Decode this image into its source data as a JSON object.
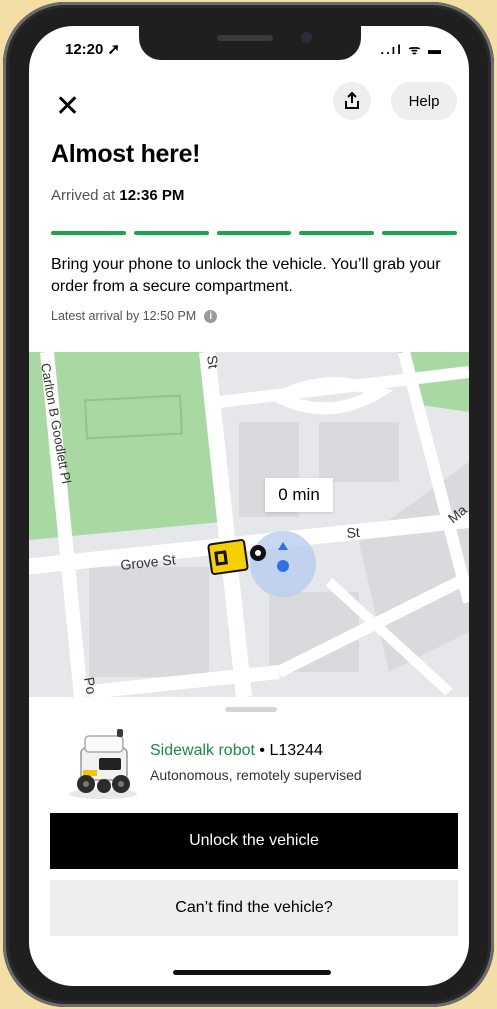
{
  "status_bar": {
    "time": "12:20 ➚",
    "icons": "..ıl ᯤ ▬"
  },
  "header": {
    "share_icon": "share-icon",
    "help_label": "Help"
  },
  "title": "Almost here!",
  "arrival": {
    "prefix": "Arrived at ",
    "time": "12:36 PM"
  },
  "progress": {
    "segments": 5,
    "completed": 5,
    "color": "#1aa54a"
  },
  "instructions": "Bring your phone to unlock the vehicle. You’ll grab your order from a secure compartment.",
  "latest_arrival": "Latest arrival by 12:50 PM",
  "map": {
    "streets": {
      "carlton": "Carlton B Goodlett Pl",
      "grove": "Grove St",
      "st_top": "St",
      "st_right": "St",
      "ma": "Ma",
      "po": "Po"
    },
    "eta": "0 min"
  },
  "vehicle": {
    "name": "Sidewalk robot",
    "separator": " • ",
    "id": "L13244",
    "description": "Autonomous, remotely supervised"
  },
  "buttons": {
    "unlock": "Unlock the vehicle",
    "cant_find": "Can’t find the vehicle?"
  },
  "colors": {
    "accent_green": "#1a8a45",
    "park_green": "#a9d9a3",
    "map_bg": "#e6e7ea"
  }
}
